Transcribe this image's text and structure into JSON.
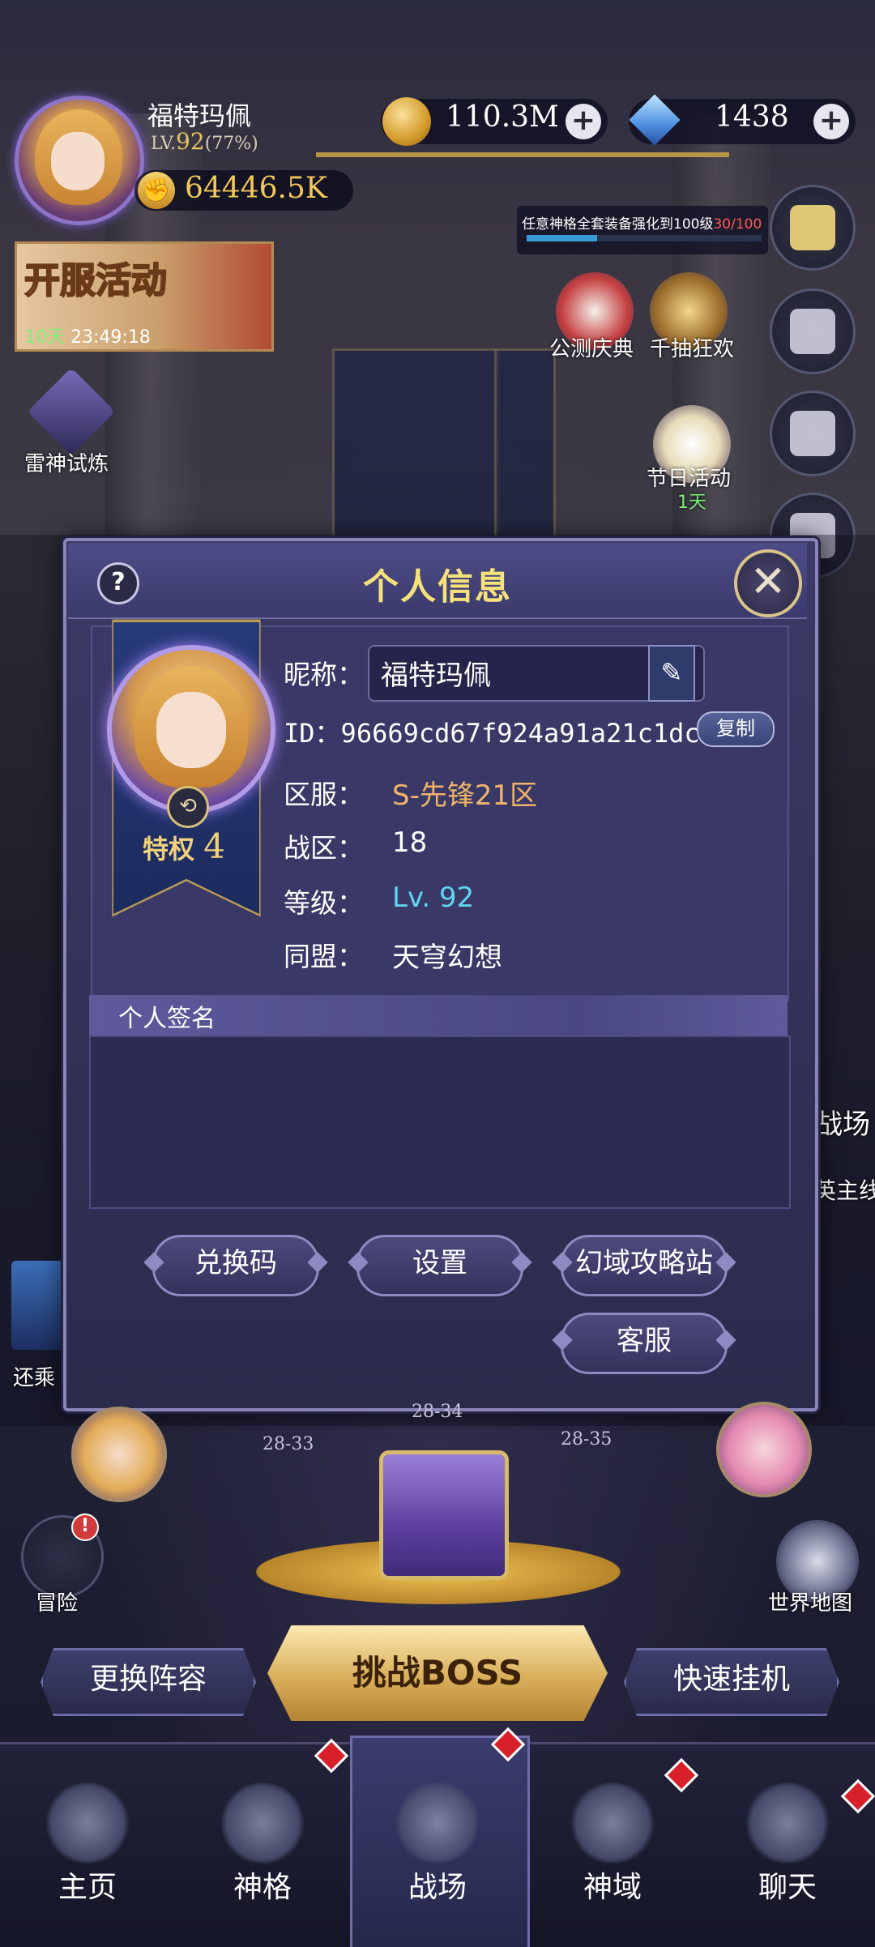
{
  "player": {
    "name": "福特玛佩",
    "level_prefix": "LV.",
    "level": "92",
    "level_pct": "(77%)",
    "power": "64446.5K",
    "xp_progress": 0.77
  },
  "resources": {
    "gold": "110.3M",
    "gems": "1438",
    "plus": "+"
  },
  "quest": {
    "text": "任意神格全套装备强化到100级",
    "progress": "30/100",
    "fraction": 0.3
  },
  "event_banner": {
    "title": "开服活动",
    "days": "10天",
    "time": "23:49:18"
  },
  "side_icons": {
    "public_test": "公测庆典",
    "draw_event": "千抽狂欢",
    "thunder_trial": "雷神试炼",
    "festival": "节日活动",
    "festival_days": "1天",
    "battlefield": "战场",
    "main_line": "英主线",
    "return": "还乘",
    "adventure": "冒险",
    "world_map": "世界地图",
    "adventure_badge": "!"
  },
  "dialog": {
    "title": "个人信息",
    "help": "?",
    "close": "✕",
    "privilege_label": "特权",
    "privilege_level": "4",
    "nickname_label": "昵称：",
    "nickname": "福特玛佩",
    "id_label": "ID：",
    "id_value": "96669cd67f924a91a21c1dcd",
    "copy_label": "复制",
    "server_label": "区服：",
    "server_value": "S-先锋21区",
    "zone_label": "战区：",
    "zone_value": "18",
    "level_label": "等级：",
    "level_value": "Lv. 92",
    "alliance_label": "同盟：",
    "alliance_value": "天穹幻想",
    "signature_label": "个人签名",
    "signature_value": "",
    "buttons": {
      "redeem": "兑换码",
      "settings": "设置",
      "guide": "幻域攻略站",
      "support": "客服"
    },
    "colors": {
      "title": "#f5e27a",
      "server": "#f0b46a",
      "level": "#5fd6f0"
    }
  },
  "stage_labels": [
    "28-34",
    "28-33",
    "28-35"
  ],
  "actions": {
    "change_lineup": "更换阵容",
    "challenge_boss": "挑战BOSS",
    "quick_idle": "快速挂机"
  },
  "nav": {
    "items": [
      "主页",
      "神格",
      "战场",
      "神域",
      "聊天"
    ],
    "selected": "战场"
  }
}
